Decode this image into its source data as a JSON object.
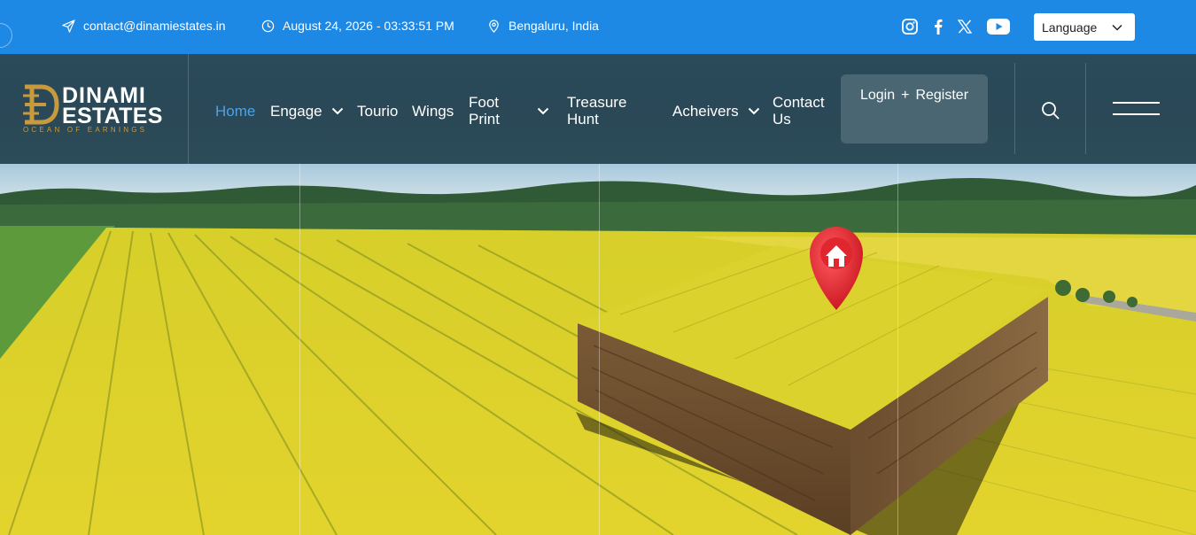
{
  "topbar": {
    "email": "contact@dinamiestates.in",
    "datetime": "August 24, 2026 - 03:33:51 PM",
    "location": "Bengaluru, India",
    "social": [
      "instagram-icon",
      "facebook-icon",
      "x-twitter-icon",
      "youtube-icon"
    ],
    "language_label": "Language"
  },
  "brand": {
    "name_line1": "DINAMI",
    "name_line2": "ESTATES",
    "tagline": "OCEAN OF EARNINGS"
  },
  "nav": {
    "home": "Home",
    "engage": "Engage",
    "tourio": "Tourio",
    "wings": "Wings",
    "foot_print": "Foot Print",
    "treasure_hunt": "Treasure Hunt",
    "achievers": "Acheivers",
    "contact_us": "Contact Us"
  },
  "auth": {
    "login": "Login",
    "plus": "+",
    "register": "Register"
  },
  "colors": {
    "topbar": "#1e88e5",
    "navbar": "#2b4a5a",
    "active_link": "#4aa3e8",
    "logo_gold": "#c99a3c",
    "pin_red": "#e0262f"
  }
}
